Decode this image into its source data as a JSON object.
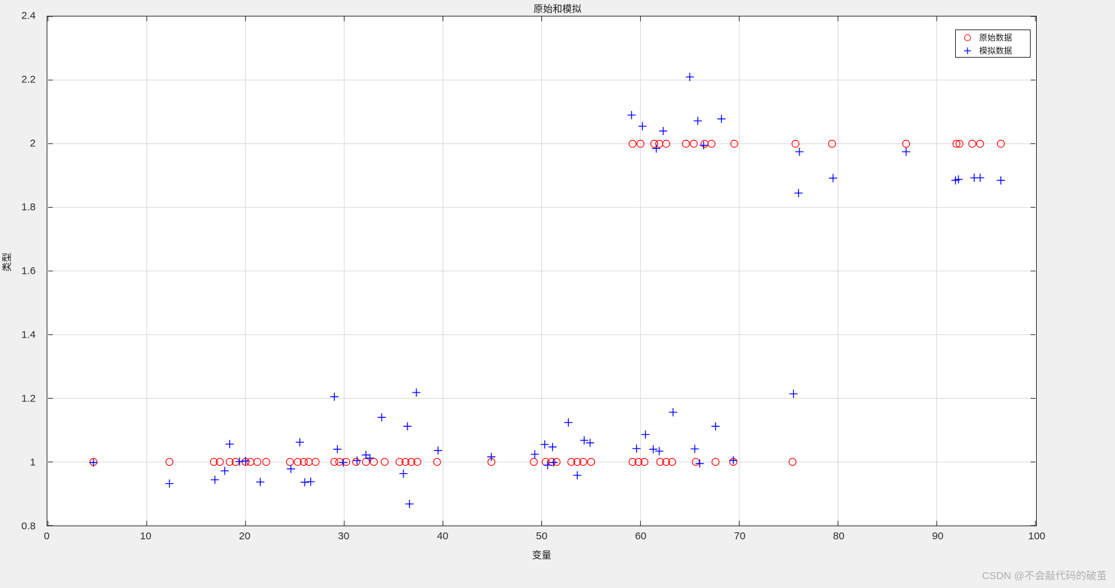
{
  "figure": {
    "title": "原始和模拟",
    "watermark": "CSDN @不会敲代码的破茧",
    "background_color": "#f0f0f0",
    "plot_background_color": "#ffffff",
    "axis_color": "#262626",
    "grid_color": "#d9d9d9"
  },
  "legend": {
    "position": "top-right",
    "entries": [
      {
        "label": "原始数据",
        "marker": "circle",
        "color": "#ff0000"
      },
      {
        "label": "模拟数据",
        "marker": "plus",
        "color": "#0000ff"
      }
    ]
  },
  "chart_data": {
    "type": "scatter",
    "title": "原始和模拟",
    "xlabel": "变量",
    "ylabel": "类型",
    "xlim": [
      0,
      100
    ],
    "ylim": [
      0.8,
      2.4
    ],
    "xticks": [
      0,
      10,
      20,
      30,
      40,
      50,
      60,
      70,
      80,
      90,
      100
    ],
    "yticks": [
      0.8,
      1,
      1.2,
      1.4,
      1.6,
      1.8,
      2,
      2.2,
      2.4
    ],
    "xtick_labels": [
      "0",
      "10",
      "20",
      "30",
      "40",
      "50",
      "60",
      "70",
      "80",
      "90",
      "100"
    ],
    "ytick_labels": [
      "0.8",
      "1",
      "1.2",
      "1.4",
      "1.6",
      "1.8",
      "2",
      "2.2",
      "2.4"
    ],
    "grid": true,
    "legend_position": "upper right",
    "series": [
      {
        "name": "原始数据",
        "marker": "circle",
        "color": "#ff0000",
        "points": [
          [
            4.6,
            1
          ],
          [
            12.3,
            1
          ],
          [
            16.8,
            1
          ],
          [
            17.4,
            1
          ],
          [
            18.4,
            1
          ],
          [
            19.0,
            1
          ],
          [
            20.0,
            1
          ],
          [
            20.5,
            1
          ],
          [
            21.2,
            1
          ],
          [
            22.1,
            1
          ],
          [
            24.5,
            1
          ],
          [
            25.3,
            1
          ],
          [
            25.9,
            1
          ],
          [
            26.4,
            1
          ],
          [
            27.1,
            1
          ],
          [
            29.0,
            1
          ],
          [
            29.5,
            1
          ],
          [
            30.2,
            1
          ],
          [
            31.2,
            1
          ],
          [
            32.2,
            1
          ],
          [
            33.0,
            1
          ],
          [
            34.1,
            1
          ],
          [
            35.6,
            1
          ],
          [
            36.2,
            1
          ],
          [
            36.8,
            1
          ],
          [
            37.4,
            1
          ],
          [
            39.4,
            1
          ],
          [
            44.9,
            1
          ],
          [
            49.2,
            1
          ],
          [
            50.4,
            1
          ],
          [
            51.0,
            1
          ],
          [
            51.5,
            1
          ],
          [
            53.0,
            1
          ],
          [
            53.6,
            1
          ],
          [
            54.2,
            1
          ],
          [
            55.0,
            1
          ],
          [
            59.2,
            1
          ],
          [
            59.8,
            1
          ],
          [
            60.4,
            1
          ],
          [
            62.0,
            1
          ],
          [
            62.6,
            1
          ],
          [
            63.2,
            1
          ],
          [
            65.6,
            1
          ],
          [
            67.6,
            1
          ],
          [
            69.4,
            1
          ],
          [
            75.4,
            1
          ],
          [
            59.2,
            2
          ],
          [
            60.0,
            2
          ],
          [
            61.4,
            2
          ],
          [
            61.9,
            2
          ],
          [
            62.6,
            2
          ],
          [
            64.6,
            2
          ],
          [
            65.4,
            2
          ],
          [
            66.5,
            2
          ],
          [
            67.2,
            2
          ],
          [
            69.5,
            2
          ],
          [
            75.7,
            2
          ],
          [
            79.4,
            2
          ],
          [
            86.9,
            2
          ],
          [
            92.0,
            2
          ],
          [
            92.3,
            2
          ],
          [
            93.6,
            2
          ],
          [
            94.4,
            2
          ],
          [
            96.5,
            2
          ]
        ]
      },
      {
        "name": "模拟数据",
        "marker": "plus",
        "color": "#0000ff",
        "points": [
          [
            4.6,
            0.998
          ],
          [
            12.3,
            0.932
          ],
          [
            16.9,
            0.944
          ],
          [
            17.9,
            0.972
          ],
          [
            18.4,
            1.056
          ],
          [
            19.4,
            1.001
          ],
          [
            20.0,
            1.003
          ],
          [
            21.5,
            0.937
          ],
          [
            24.6,
            0.978
          ],
          [
            25.5,
            1.062
          ],
          [
            26.0,
            0.936
          ],
          [
            26.6,
            0.938
          ],
          [
            29.0,
            1.205
          ],
          [
            29.3,
            1.04
          ],
          [
            29.9,
            0.998
          ],
          [
            31.3,
            1.004
          ],
          [
            32.2,
            1.022
          ],
          [
            32.6,
            1.012
          ],
          [
            33.8,
            1.14
          ],
          [
            36.0,
            0.963
          ],
          [
            36.4,
            1.112
          ],
          [
            36.6,
            0.868
          ],
          [
            37.3,
            1.218
          ],
          [
            39.5,
            1.036
          ],
          [
            44.9,
            1.016
          ],
          [
            49.3,
            1.024
          ],
          [
            50.3,
            1.055
          ],
          [
            50.6,
            0.99
          ],
          [
            51.1,
            1.047
          ],
          [
            51.2,
            0.998
          ],
          [
            52.7,
            1.124
          ],
          [
            53.6,
            0.958
          ],
          [
            54.3,
            1.068
          ],
          [
            54.9,
            1.06
          ],
          [
            59.6,
            1.042
          ],
          [
            60.5,
            1.086
          ],
          [
            61.3,
            1.04
          ],
          [
            61.9,
            1.034
          ],
          [
            63.3,
            1.156
          ],
          [
            65.5,
            1.041
          ],
          [
            66.0,
            0.995
          ],
          [
            67.6,
            1.112
          ],
          [
            69.4,
            1.005
          ],
          [
            75.5,
            1.214
          ],
          [
            59.1,
            2.09
          ],
          [
            60.2,
            2.055
          ],
          [
            61.6,
            1.985
          ],
          [
            62.3,
            2.04
          ],
          [
            65.0,
            2.21
          ],
          [
            65.8,
            2.072
          ],
          [
            66.4,
            1.995
          ],
          [
            68.2,
            2.078
          ],
          [
            76.0,
            1.845
          ],
          [
            76.1,
            1.975
          ],
          [
            79.5,
            1.892
          ],
          [
            86.9,
            1.975
          ],
          [
            91.9,
            1.885
          ],
          [
            92.2,
            1.888
          ],
          [
            93.8,
            1.893
          ],
          [
            94.4,
            1.893
          ],
          [
            96.5,
            1.885
          ]
        ]
      }
    ]
  }
}
